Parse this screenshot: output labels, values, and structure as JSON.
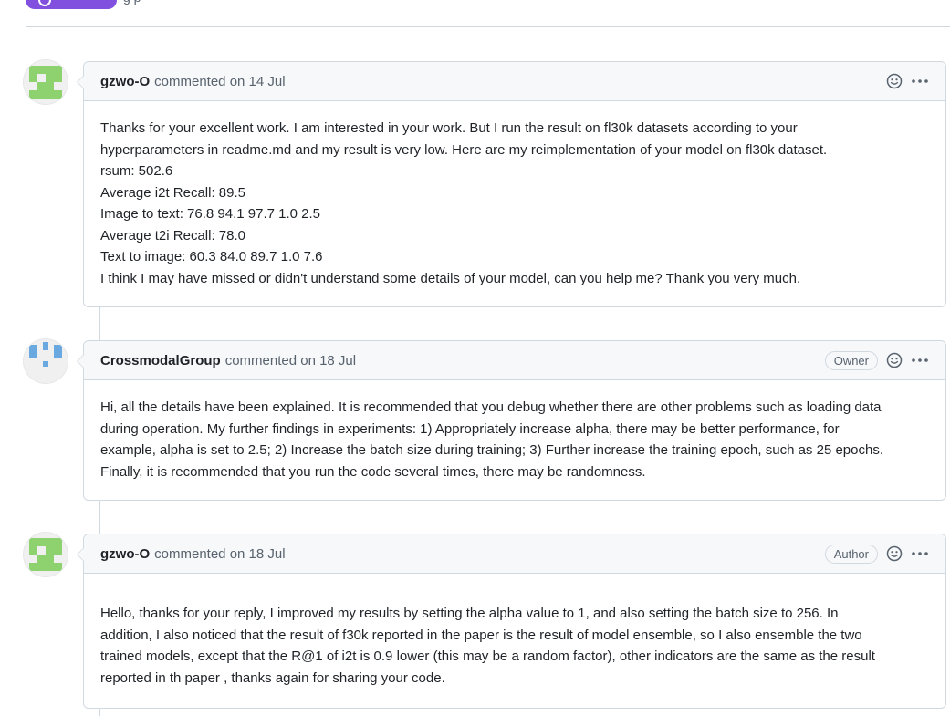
{
  "top_fragment": {
    "text": "g    p"
  },
  "comments": [
    {
      "author": "gzwo-O",
      "meta": "commented on 14 Jul",
      "role": "",
      "avatar": "gzwo-O-avatar",
      "lines": [
        "Thanks for your excellent work. I am interested in your work. But I run the result on fl30k datasets according to your",
        "hyperparameters in readme.md and my result is very low. Here are my reimplementation of your model on fl30k dataset.",
        "rsum: 502.6",
        "Average i2t Recall: 89.5",
        "Image to text: 76.8 94.1 97.7 1.0 2.5",
        "Average t2i Recall: 78.0",
        "Text to image: 60.3 84.0 89.7 1.0 7.6",
        "I think I may have missed or didn't understand some details of your model, can you help me? Thank you very much."
      ]
    },
    {
      "author": "CrossmodalGroup",
      "meta": "commented on 18 Jul",
      "role": "Owner",
      "avatar": "CrossmodalGroup-avatar",
      "lines": [
        "Hi, all the details have been explained. It is recommended that you debug whether there are other problems such as loading data",
        "during operation. My further findings in experiments: 1) Appropriately increase alpha, there may be better performance, for",
        "example, alpha is set to 2.5; 2) Increase the batch size during training; 3) Further increase the training epoch, such as 25 epochs.",
        "Finally, it is recommended that you run the code several times, there may be randomness."
      ]
    },
    {
      "author": "gzwo-O",
      "meta": "commented on 18 Jul",
      "role": "Author",
      "avatar": "gzwo-O-avatar",
      "lines": [
        "Hello, thanks for your reply, I improved my results by setting the alpha value to 1, and also setting the batch size to 256. In",
        "addition, I also noticed that the result of f30k reported in the paper is the result of model ensemble, so I also ensemble the two",
        "trained models, except that the R@1 of i2t is 0.9 lower (this may be a random factor), other indicators are the same as the result",
        "reported in th paper , thanks again for sharing your code."
      ]
    }
  ],
  "icons": {
    "reaction": "smiley-icon",
    "more": "kebab-horizontal-icon"
  },
  "colors": {
    "accent_purple": "#8250df",
    "avatar_green": "#8ed16f",
    "avatar_blue": "#6aa9e0",
    "border": "#d1d9e0",
    "header_bg": "#f6f8fa",
    "muted_text": "#59636e"
  }
}
